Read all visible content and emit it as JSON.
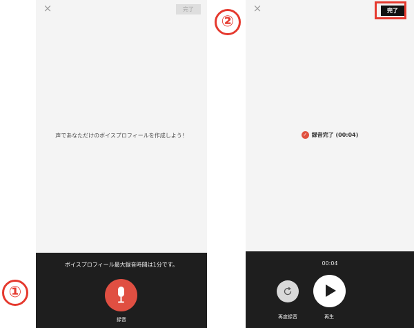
{
  "panel1": {
    "close_icon": "×",
    "done_label": "完了",
    "prompt": "声であなただけのボイスプロフィールを作成しよう！",
    "note": "ボイスプロフィール最大録音時間は1分です。",
    "record_label": "録音"
  },
  "panel2": {
    "close_icon": "×",
    "done_label": "完了",
    "status_text": "録音完了 (00:04)",
    "timer": "00:04",
    "rerecord_label": "再度録音",
    "play_label": "再生"
  },
  "markers": {
    "step1": "①",
    "step2": "②"
  },
  "colors": {
    "accent_red": "#e04f42",
    "highlight_red": "#e5392e",
    "bottom_bar": "#1e1e1e"
  }
}
